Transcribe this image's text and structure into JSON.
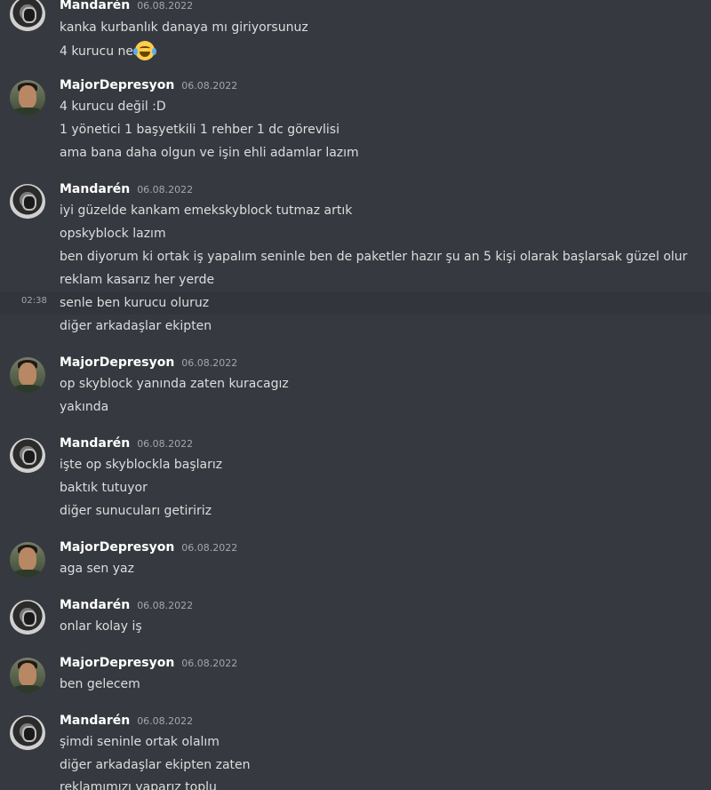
{
  "users": {
    "mandaren": "Mandarén",
    "major": "MajorDepresyon"
  },
  "colors": {
    "background": "#36393f",
    "username": "#ffffff",
    "message_text": "#dcddde",
    "timestamp": "#a3a6aa",
    "hover_background": "#32353b"
  },
  "messages": [
    {
      "author": "Mandarén",
      "date": "06.08.2022",
      "lines": [
        "kanka kurbanlık danaya mı giriyorsunuz",
        "4 kurucu ne"
      ],
      "emoji": "joy-emoji"
    },
    {
      "author": "MajorDepresyon",
      "date": "06.08.2022",
      "lines": [
        "4 kurucu değil :D",
        "1 yönetici 1 başyetkili 1 rehber 1 dc görevlisi",
        "ama bana daha olgun ve işin ehli adamlar lazım"
      ]
    },
    {
      "author": "Mandarén",
      "date": "06.08.2022",
      "lines": [
        "iyi güzelde kankam emekskyblock tutmaz artık",
        "opskyblock lazım",
        "ben diyorum ki ortak iş yapalım seninle ben de paketler hazır şu an 5 kişi olarak başlarsak güzel olur",
        "reklam kasarız her yerde",
        "senle ben kurucu oluruz",
        "diğer arkadaşlar ekipten"
      ],
      "hover_time": "02:38"
    },
    {
      "author": "MajorDepresyon",
      "date": "06.08.2022",
      "lines": [
        "op skyblock yanında zaten kuracagız",
        "yakında"
      ]
    },
    {
      "author": "Mandarén",
      "date": "06.08.2022",
      "lines": [
        "işte op skyblockla başlarız",
        "baktık tutuyor",
        "diğer sunucuları getiririz"
      ]
    },
    {
      "author": "MajorDepresyon",
      "date": "06.08.2022",
      "lines": [
        "aga sen yaz"
      ]
    },
    {
      "author": "Mandarén",
      "date": "06.08.2022",
      "lines": [
        "onlar kolay iş"
      ]
    },
    {
      "author": "MajorDepresyon",
      "date": "06.08.2022",
      "lines": [
        "ben gelecem"
      ]
    },
    {
      "author": "Mandarén",
      "date": "06.08.2022",
      "lines": [
        "şimdi seninle ortak olalım",
        "diğer arkadaşlar ekipten zaten",
        "reklamımızı yaparız toplu"
      ]
    }
  ]
}
